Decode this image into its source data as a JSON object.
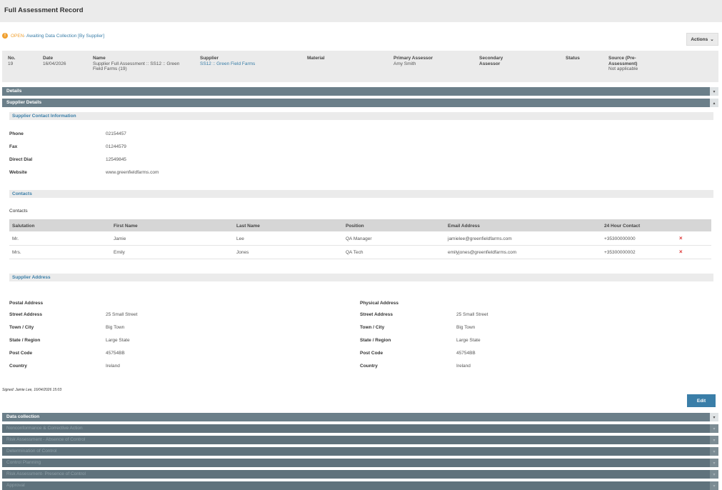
{
  "page_title": "Full Assessment Record",
  "status": {
    "icon": "warning-icon",
    "open_label": "OPEN",
    "rest": " - Awaiting Data Collection [By Supplier]"
  },
  "actions_label": "Actions",
  "summary": {
    "no_label": "No.",
    "no_value": "19",
    "date_label": "Date",
    "date_value": "16/04/2026",
    "name_label": "Name",
    "name_value": "Supplier Full Assessment :: SS12 :: Green Field Farms (19)",
    "supplier_label": "Supplier",
    "supplier_value": "SS12 :: Green Field Farms",
    "material_label": "Material",
    "primary_label": "Primary Assessor",
    "primary_value": "Amy Smith",
    "secondary_label": "Secondary Assessor",
    "status_label": "Status",
    "source_label": "Source (Pre-Assessment)",
    "source_value": "Not applicable"
  },
  "sections": {
    "details": "Details",
    "supplier_details": "Supplier Details",
    "data_collection": "Data collection",
    "nonconformance": "Nonconformance & Corrective Action",
    "risk_absence": "Risk Assessment - Absence of Control",
    "determination": "Determination of Control",
    "control_planning": "Control Planning",
    "risk_presence": "Risk Assessment- Presence of Control",
    "approval": "Approval"
  },
  "contact_info": {
    "heading": "Supplier Contact Information",
    "phone_label": "Phone",
    "phone": "02154457",
    "fax_label": "Fax",
    "fax": "01244579",
    "dial_label": "Direct Dial",
    "dial": "12549845",
    "website_label": "Website",
    "website": "www.greenfieldfarms.com"
  },
  "contacts": {
    "heading": "Contacts",
    "subtitle": "Contacts",
    "columns": [
      "Salutation",
      "First Name",
      "Last Name",
      "Position",
      "Email Address",
      "24 Hour Contact"
    ],
    "rows": [
      [
        "Mr.",
        "Jamie",
        "Lee",
        "QA Manager",
        "jamielee@greenfieldfarms.com",
        "+35300000000"
      ],
      [
        "Mrs.",
        "Emily",
        "Jones",
        "QA Tech",
        "emilyjones@greenfieldfarms.com",
        "+35300000002"
      ]
    ],
    "delete_glyph": "×"
  },
  "address": {
    "heading": "Supplier Address",
    "postal_title": "Postal Address",
    "physical_title": "Physical Address",
    "street_label": "Street Address",
    "town_label": "Town / City",
    "state_label": "State / Region",
    "post_label": "Post Code",
    "country_label": "Country",
    "postal": {
      "street": "25 Small Street",
      "town": "Big Town",
      "state": "Large State",
      "post": "45754BB",
      "country": "Ireland"
    },
    "physical": {
      "street": "25 Small Street",
      "town": "Big Town",
      "state": "Large State",
      "post": "45754BB",
      "country": "Ireland"
    }
  },
  "signed": "Signed: Jamie Lee, 16/04/2026 15:03",
  "edit_label": "Edit",
  "toggle_down": "▾",
  "toggle_up": "▴",
  "colors": {
    "accent": "#3a7ea8",
    "warning": "#f0a030",
    "section_bar": "#6b7f89",
    "delete": "#dd3333"
  }
}
